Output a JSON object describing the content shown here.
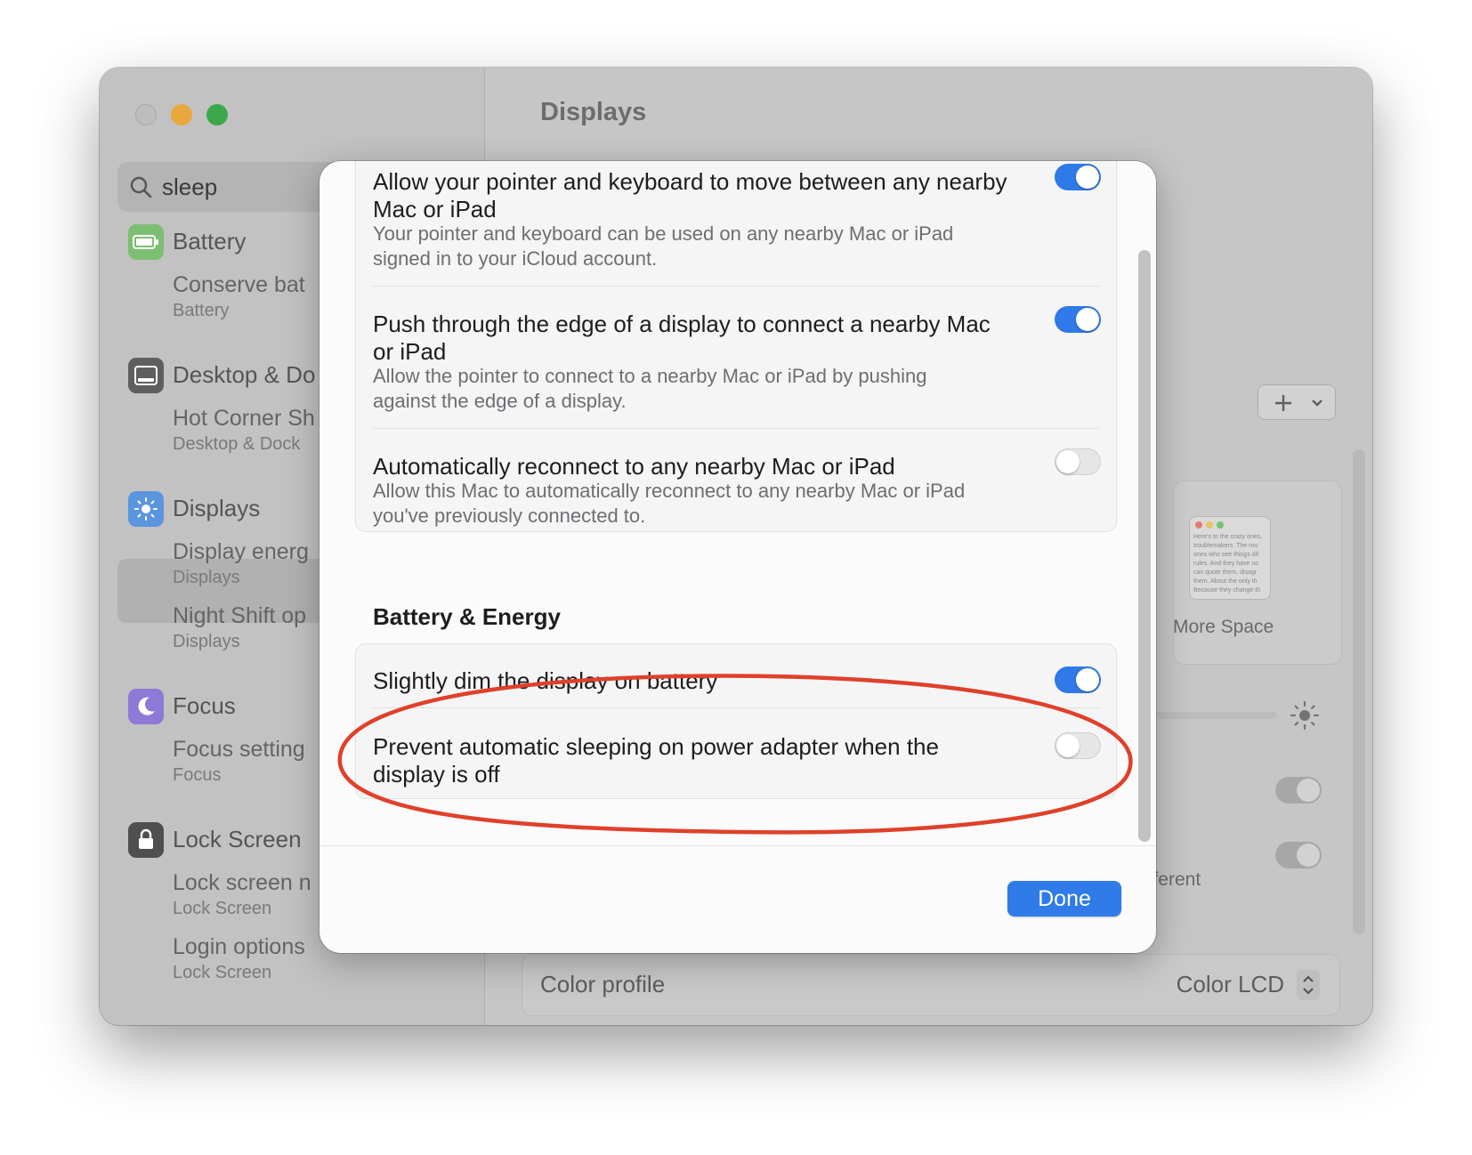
{
  "sidebar": {
    "search": {
      "value": "sleep"
    },
    "groups": [
      {
        "icon": "battery-icon",
        "title": "Battery",
        "items": [
          {
            "label": "Conserve bat",
            "caption": "Battery"
          }
        ]
      },
      {
        "icon": "desktop-dock-icon",
        "title": "Desktop & Do",
        "items": [
          {
            "label": "Hot Corner Sh",
            "caption": "Desktop & Dock"
          }
        ]
      },
      {
        "icon": "displays-icon",
        "title": "Displays",
        "items": [
          {
            "label": "Display energ",
            "caption": "Displays"
          },
          {
            "label": "Night Shift op",
            "caption": "Displays"
          }
        ]
      },
      {
        "icon": "focus-icon",
        "title": "Focus",
        "items": [
          {
            "label": "Focus setting",
            "caption": "Focus"
          }
        ]
      },
      {
        "icon": "lock-screen-icon",
        "title": "Lock Screen",
        "items": [
          {
            "label": "Lock screen n",
            "caption": "Lock Screen"
          },
          {
            "label": "Login options",
            "caption": "Lock Screen"
          }
        ]
      }
    ]
  },
  "main": {
    "title": "Displays",
    "preview_label": "More Space",
    "preview_text": "Here's to the crazy ones, troublemakers. The rou ones who see things dif rules. And they have no can quote them, disagr them. About the only th Because they change th",
    "fragment_text": "fferent",
    "color_profile": {
      "label": "Color profile",
      "value": "Color LCD"
    }
  },
  "sheet": {
    "rows_top": [
      {
        "title_line1": "Allow your pointer and keyboard to move between any nearby",
        "title_line2": "Mac or iPad",
        "desc_line1": "Your pointer and keyboard can be used on any nearby Mac or iPad",
        "desc_line2": "signed in to your iCloud account.",
        "on": true
      },
      {
        "title_line1": "Push through the edge of a display to connect a nearby Mac",
        "title_line2": "or iPad",
        "desc_line1": "Allow the pointer to connect to a nearby Mac or iPad by pushing",
        "desc_line2": "against the edge of a display.",
        "on": true
      },
      {
        "title_line1": "Automatically reconnect to any nearby Mac or iPad",
        "desc_line1": "Allow this Mac to automatically reconnect to any nearby Mac or iPad",
        "desc_line2": "you've previously connected to.",
        "on": false
      }
    ],
    "section_title": "Battery & Energy",
    "rows_battery": [
      {
        "title_line1": "Slightly dim the display on battery",
        "on": true
      },
      {
        "title_line1": "Prevent automatic sleeping on power adapter when the",
        "title_line2": "display is off",
        "on": false
      }
    ],
    "done_label": "Done"
  },
  "colors": {
    "accent": "#2f79e8",
    "annotation": "#e0402a"
  }
}
